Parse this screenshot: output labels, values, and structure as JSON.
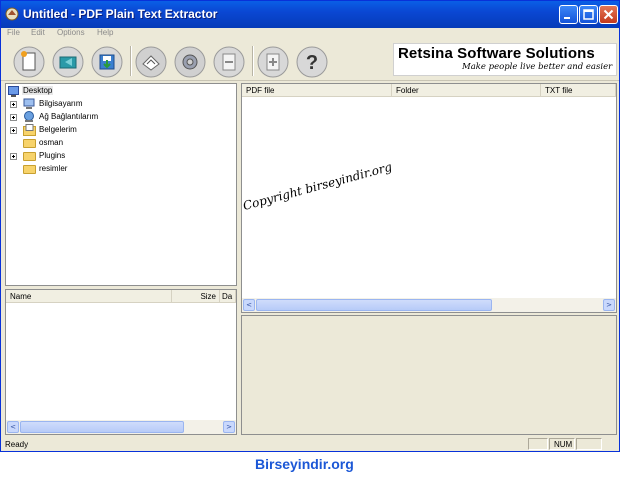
{
  "window": {
    "title": "Untitled - PDF Plain Text Extractor"
  },
  "menu": {
    "items": [
      "File",
      "Edit",
      "Options",
      "Help"
    ]
  },
  "toolbar": {
    "buttons": [
      {
        "icon": "new-document-icon"
      },
      {
        "icon": "open-folder-icon"
      },
      {
        "icon": "save-icon"
      },
      {
        "icon": "extract-icon"
      },
      {
        "icon": "settings-gear-icon"
      },
      {
        "icon": "remove-icon"
      },
      {
        "icon": "add-icon"
      },
      {
        "icon": "help-icon"
      }
    ]
  },
  "banner": {
    "title": "Retsina Software Solutions",
    "subtitle": "Make people live better and easier"
  },
  "tree": {
    "root": "Desktop",
    "items": [
      {
        "label": "Bilgisayarım",
        "expandable": true,
        "icon": "computer-icon"
      },
      {
        "label": "Ağ Bağlantılarım",
        "expandable": true,
        "icon": "network-icon"
      },
      {
        "label": "Belgelerim",
        "expandable": true,
        "icon": "documents-icon"
      },
      {
        "label": "osman",
        "expandable": false,
        "icon": "folder-icon"
      },
      {
        "label": "Plugins",
        "expandable": true,
        "icon": "folder-icon"
      },
      {
        "label": "resimler",
        "expandable": false,
        "icon": "folder-icon"
      }
    ]
  },
  "file_list": {
    "columns": [
      "Name",
      "Size",
      "Da"
    ]
  },
  "pdf_list": {
    "columns": [
      "PDF file",
      "Folder",
      "TXT file"
    ],
    "watermark": "Copyright birseyindir.org"
  },
  "status": {
    "text": "Ready",
    "num": "NUM"
  },
  "footer_watermark": "Birseyindir.org",
  "colors": {
    "title_bar": "#0a47d3",
    "window_bg": "#ece9d8",
    "watermark_blue": "#1b57d6"
  }
}
